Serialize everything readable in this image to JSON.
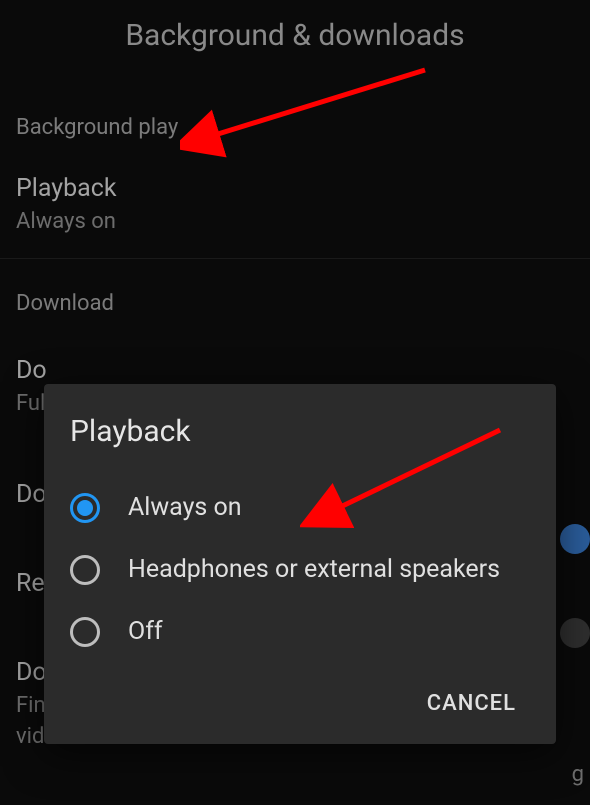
{
  "page_title": "Background & downloads",
  "sections": {
    "background_play": {
      "header": "Background play",
      "playback": {
        "title": "Playback",
        "value": "Always on"
      }
    },
    "download": {
      "header": "Download",
      "row1": {
        "title_fragment": "Do",
        "sub_fragment": "Ful"
      },
      "row2": {
        "title_fragment": "Do"
      },
      "row3": {
        "title_fragment": "Re"
      },
      "row4": {
        "title_fragment": "Do",
        "sub_fragment1": "Fin",
        "sub_fragment2": "vid",
        "sub_trail": "g"
      }
    }
  },
  "dialog": {
    "title": "Playback",
    "options": [
      {
        "label": "Always on",
        "selected": true
      },
      {
        "label": "Headphones or external speakers",
        "selected": false
      },
      {
        "label": "Off",
        "selected": false
      }
    ],
    "cancel": "CANCEL"
  },
  "annotation_color": "#ff0000"
}
